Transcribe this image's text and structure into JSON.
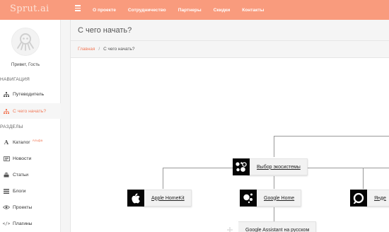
{
  "app": {
    "logo": "Sprut.ai"
  },
  "topnav": {
    "items": [
      {
        "label": "О проекте"
      },
      {
        "label": "Сотрудничество"
      },
      {
        "label": "Партнеры"
      },
      {
        "label": "Скидки"
      },
      {
        "label": "Контакты"
      }
    ]
  },
  "user": {
    "greeting": "Привет, Гость"
  },
  "sidebar": {
    "section_nav": "НАВИГАЦИЯ",
    "section_parts": "РАЗДЕЛЫ",
    "nav": [
      {
        "label": "Путеводитель",
        "icon": "sitemap-icon"
      },
      {
        "label": "С чего начать?",
        "icon": "sitemap-icon",
        "active": true
      }
    ],
    "parts": [
      {
        "label": "Каталог",
        "badge": "Альфа",
        "icon": "font-icon"
      },
      {
        "label": "Новости",
        "icon": "newspaper-icon"
      },
      {
        "label": "Статьи",
        "icon": "stack-icon"
      },
      {
        "label": "Блоги",
        "icon": "list-icon"
      },
      {
        "label": "Проекты",
        "icon": "eye-icon"
      },
      {
        "label": "Плагины",
        "icon": "code-icon"
      }
    ]
  },
  "page": {
    "title": "С чего начать?"
  },
  "breadcrumb": {
    "home": "Главная",
    "separator": "/",
    "current": "С чего начать?"
  },
  "diagram": {
    "root": "Выбор экосистемы",
    "children": [
      {
        "label": "Apple HomeKit"
      },
      {
        "label": "Google Home"
      },
      {
        "label": "Янде"
      }
    ],
    "grandchild": "Google Assistant на русском"
  },
  "colors": {
    "accent": "#f99b7d",
    "accent_text": "#f27b5a"
  }
}
